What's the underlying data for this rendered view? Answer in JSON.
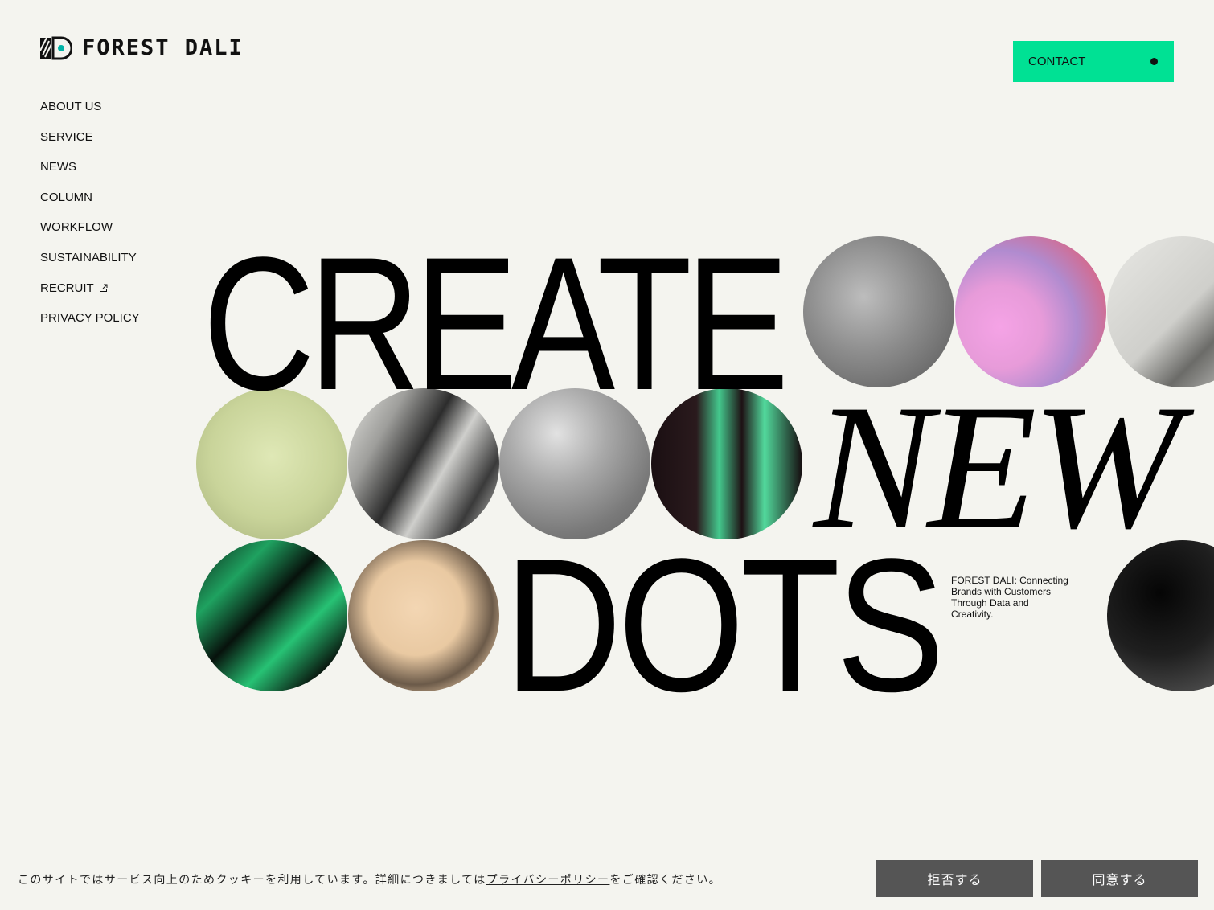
{
  "header": {
    "logo_text": "FOREST DALI",
    "contact_label": "CONTACT"
  },
  "nav": {
    "items": [
      {
        "label": "ABOUT US"
      },
      {
        "label": "SERVICE"
      },
      {
        "label": "NEWS"
      },
      {
        "label": "COLUMN"
      },
      {
        "label": "WORKFLOW"
      },
      {
        "label": "SUSTAINABILITY"
      },
      {
        "label": "RECRUIT",
        "icon": "external-link-icon"
      },
      {
        "label": "PRIVACY POLICY"
      }
    ]
  },
  "hero": {
    "word1": "CREATE",
    "word2": "NEW",
    "word3": "DOTS",
    "tagline": "FOREST DALI: Connecting Brands with Customers Through Data and Creativity."
  },
  "cookie": {
    "text_before": "このサイトではサービス向上のためクッキーを利用しています。詳細につきましては",
    "link_text": "プライバシーポリシー",
    "text_after": "をご確認ください。",
    "reject_label": "拒否する",
    "accept_label": "同意する"
  },
  "colors": {
    "background": "#f4f4ef",
    "accent": "#00e194",
    "text": "#111111",
    "cookie_button": "#555555"
  }
}
